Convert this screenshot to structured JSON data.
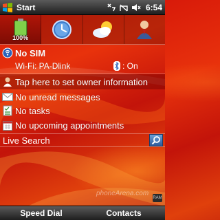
{
  "status_bar": {
    "start_label": "Start",
    "time": "6:54",
    "icons": [
      "connectivity-icon",
      "no-signal-icon",
      "volume-icon"
    ]
  },
  "shortcuts": [
    {
      "name": "battery-shortcut",
      "label": "100%"
    },
    {
      "name": "clock-shortcut",
      "label": ""
    },
    {
      "name": "weather-shortcut",
      "label": ""
    },
    {
      "name": "contacts-shortcut",
      "label": ""
    }
  ],
  "today": {
    "sim_status": "No SIM",
    "wifi": "Wi-Fi: PA-Dlink",
    "bluetooth": ": On",
    "owner": "Tap here to set owner information",
    "messages": "No unread messages",
    "tasks": "No tasks",
    "appointments": "No upcoming appointments"
  },
  "search": {
    "label": "Live Search"
  },
  "watermark": "phoneArena.com",
  "ram_logo": "RAM",
  "softkeys": {
    "left": "Speed Dial",
    "right": "Contacts"
  },
  "colors": {
    "accent": "#e0300c",
    "bar": "#2a2a2a"
  }
}
